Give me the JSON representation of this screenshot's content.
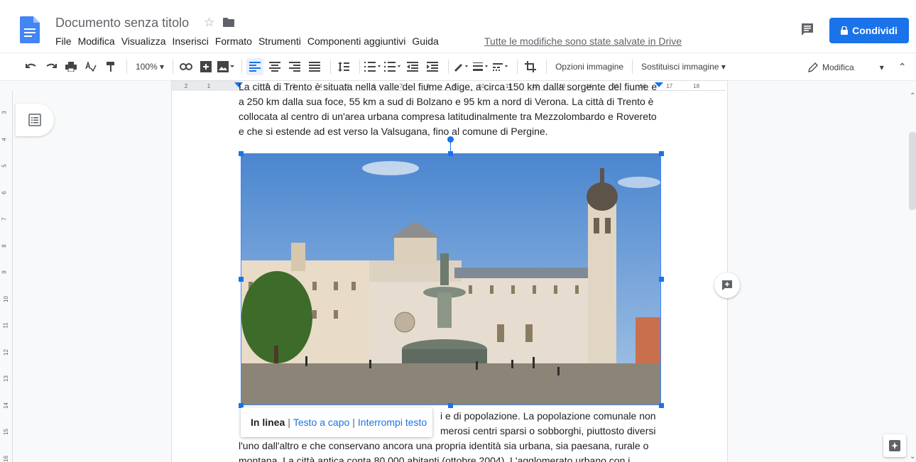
{
  "app": {
    "doc_title": "Documento senza titolo",
    "saved_status": "Tutte le modifiche sono state salvate in Drive",
    "share_label": "Condividi"
  },
  "menu": [
    "File",
    "Modifica",
    "Visualizza",
    "Inserisci",
    "Formato",
    "Strumenti",
    "Componenti aggiuntivi",
    "Guida"
  ],
  "toolbar": {
    "zoom": "100%",
    "image_options": "Opzioni immagine",
    "replace_image": "Sostituisci immagine",
    "edit_mode": "Modifica"
  },
  "ruler": {
    "h_ticks": [
      "2",
      "1",
      "1",
      "2",
      "3",
      "4",
      "5",
      "6",
      "7",
      "8",
      "9",
      "10",
      "11",
      "12",
      "13",
      "14",
      "15",
      "16",
      "17",
      "18"
    ],
    "v_ticks": [
      "3",
      "4",
      "5",
      "6",
      "7",
      "8",
      "9",
      "10",
      "11",
      "12",
      "13",
      "14",
      "15",
      "16"
    ]
  },
  "document": {
    "para1": "La città di Trento è situata nella valle del fiume Adige, a circa 150 km dalla sorgente del fiume e a 250 km dalla sua foce, 55 km a sud di Bolzano e 95 km a nord di Verona. La città di Trento è collocata al centro di un'area urbana compresa latitudinalmente tra Mezzolombardo e Rovereto e che si estende ad est verso la Valsugana, fino al comune di Pergine.",
    "para2_line1": "i e di popolazione. La popolazione comunale non",
    "para2_line2": "merosi centri sparsi o sobborghi, piuttosto diversi",
    "para2_line3": "l'uno dall'altro e che conservano ancora una propria identità sia urbana, sia paesana, rurale o",
    "para2_line4": "montana. La città antica conta 80 000 abitanti (ottobre 2004). L'agglomerato urbano con i"
  },
  "wrap_popup": {
    "inline": "In linea",
    "wrap": "Testo a capo",
    "break": "Interrompi testo"
  },
  "colors": {
    "accent": "#1a73e8",
    "doc_blue": "#4285f4"
  }
}
